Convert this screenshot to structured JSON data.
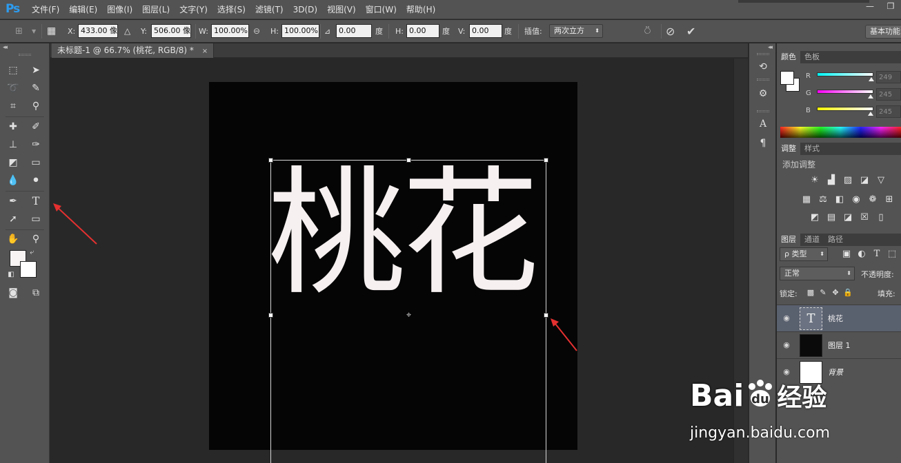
{
  "app": {
    "logo": "Ps"
  },
  "menu": [
    "文件(F)",
    "编辑(E)",
    "图像(I)",
    "图层(L)",
    "文字(Y)",
    "选择(S)",
    "滤镜(T)",
    "3D(D)",
    "视图(V)",
    "窗口(W)",
    "帮助(H)"
  ],
  "window_controls": {
    "minimize": "—",
    "restore": "❐"
  },
  "options": {
    "x_label": "X:",
    "x_value": "433.00 像",
    "y_label": "Y:",
    "y_value": "506.00 像",
    "w_label": "W:",
    "w_value": "100.00%",
    "h_label": "H:",
    "h_value": "100.00%",
    "angle_value": "0.00",
    "angle_unit": "度",
    "hskew_label": "H:",
    "hskew_value": "0.00",
    "hskew_unit": "度",
    "vskew_label": "V:",
    "vskew_value": "0.00",
    "vskew_unit": "度",
    "interp_label": "插值:",
    "interp_value": "两次立方",
    "workspace": "基本功能"
  },
  "document": {
    "tab_title": "未标题-1 @ 66.7% (桃花, RGB/8) *",
    "close": "×",
    "text_content": "桃花"
  },
  "color_panel": {
    "tabs": [
      "颜色",
      "色板"
    ],
    "r_label": "R",
    "r_value": "249",
    "g_label": "G",
    "g_value": "245",
    "b_label": "B",
    "b_value": "245"
  },
  "adjust_panel": {
    "tabs": [
      "调整",
      "样式"
    ],
    "hint": "添加调整"
  },
  "layers_panel": {
    "tabs": [
      "图层",
      "通道",
      "路径"
    ],
    "filter_kind": "ρ 类型",
    "blend_mode": "正常",
    "opacity_label": "不透明度:",
    "lock_label": "锁定:",
    "fill_label": "填充:",
    "layers": [
      {
        "name": "桃花",
        "thumb": "T"
      },
      {
        "name": "图层 1"
      },
      {
        "name": "背景"
      }
    ]
  },
  "watermark": {
    "brand": "Bai",
    "brand_suffix": "经验",
    "url": "jingyan.baidu.com"
  },
  "colors": {
    "accent_ps": "#2c9cf0",
    "arrow_red": "#e53030",
    "text_fill": "#f6f0f0"
  }
}
